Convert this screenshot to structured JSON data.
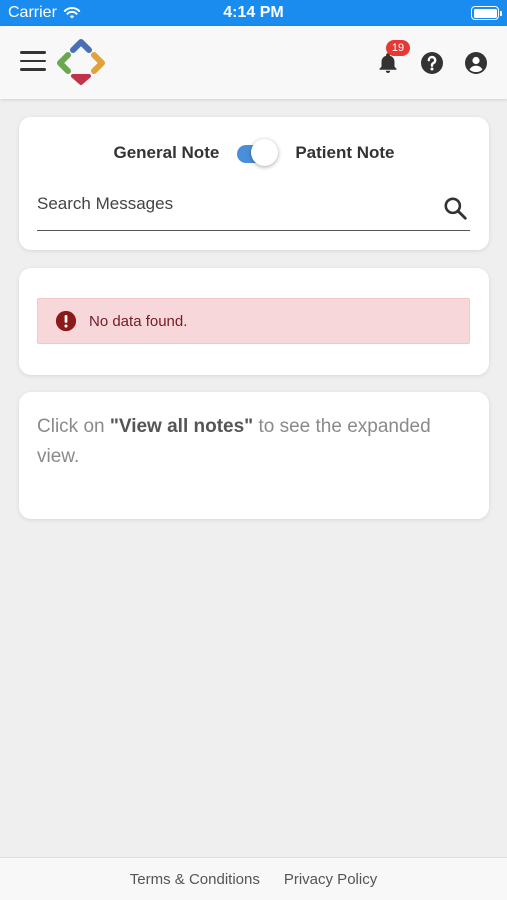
{
  "status_bar": {
    "carrier": "Carrier",
    "time": "4:14 PM"
  },
  "header": {
    "notification_count": "19",
    "icons": {
      "menu": "hamburger-menu-icon",
      "logo": "app-logo",
      "notifications": "bell-icon",
      "help": "question-circle-icon",
      "account": "account-circle-icon"
    }
  },
  "notes": {
    "general_label": "General Note",
    "patient_label": "Patient Note",
    "toggle_on": true,
    "search_placeholder": "Search Messages",
    "search_value": ""
  },
  "results": {
    "alert_text": "No data found."
  },
  "info": {
    "prefix": "Click on ",
    "link_text": "\"View all notes\"",
    "suffix": " to see the expanded view."
  },
  "footer": {
    "terms": "Terms & Conditions",
    "privacy": "Privacy Policy"
  },
  "colors": {
    "status_bar": "#1a8cf0",
    "toggle_track": "#4a8fd8",
    "badge": "#e53935",
    "alert_bg": "#f8d7da",
    "alert_text": "#721c24",
    "logo_blue": "#4a6fb5",
    "logo_green": "#6aa84f",
    "logo_orange": "#e0a23a",
    "logo_red": "#c0334a"
  }
}
